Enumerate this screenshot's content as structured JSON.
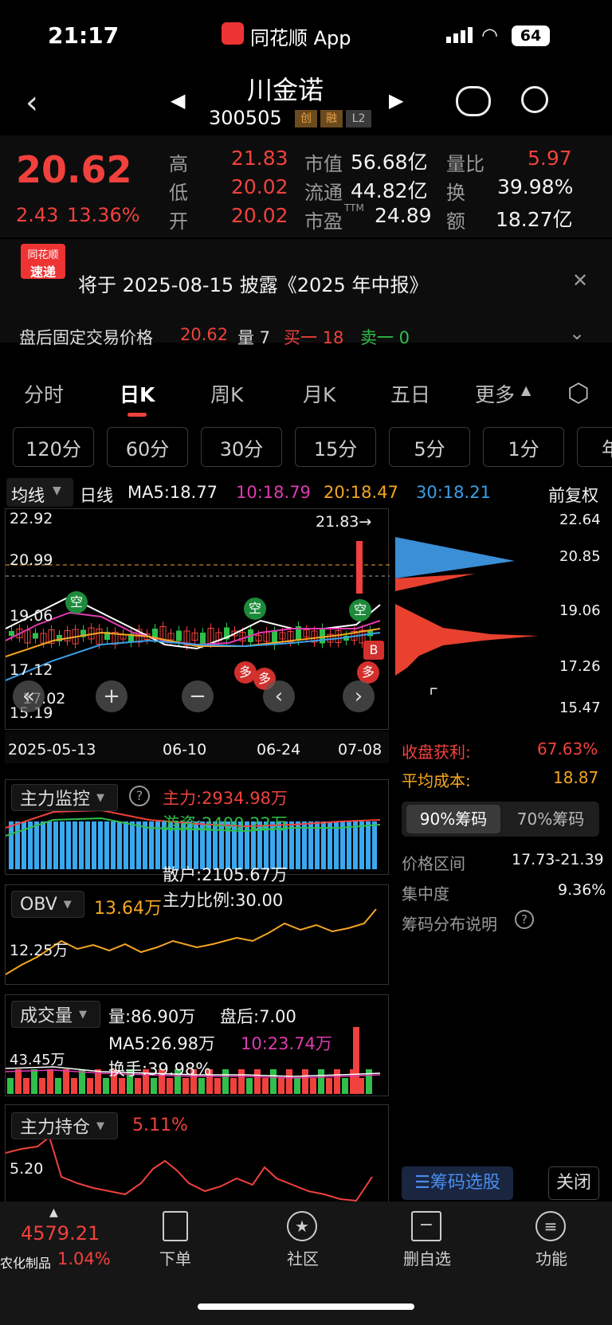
{
  "status": {
    "time": "21:17",
    "app": "同花顺 App",
    "battery": "64"
  },
  "header": {
    "name": "川金诺",
    "code": "300505",
    "tags": [
      "创",
      "融",
      "L2"
    ]
  },
  "quote": {
    "price": "20.62",
    "change": "2.43",
    "pct": "13.36%",
    "high_label": "高",
    "high": "21.83",
    "low_label": "低",
    "low": "20.02",
    "open_label": "开",
    "open": "20.02",
    "mcap_label": "市值",
    "mcap": "56.68亿",
    "float_label": "流通",
    "float": "44.82亿",
    "pe_label": "市盈",
    "pe_sup": "TTM",
    "pe": "24.89",
    "vr_label": "量比",
    "vr": "5.97",
    "turn_label": "换",
    "turn": "39.98%",
    "amt_label": "额",
    "amt": "18.27亿"
  },
  "news": {
    "logo1": "同花顺",
    "logo2": "速递",
    "text": "将于 2025-08-15 披露《2025 年中报》"
  },
  "after": {
    "label": "盘后固定交易价格",
    "price": "20.62",
    "vol": "量 7",
    "buy": "买一 18",
    "sell": "卖一 0"
  },
  "tabs": [
    "分时",
    "日K",
    "周K",
    "月K",
    "五日",
    "更多"
  ],
  "periods": [
    "120分",
    "60分",
    "30分",
    "15分",
    "5分",
    "1分",
    "年"
  ],
  "ma": {
    "sel": "均线",
    "type": "日线",
    "ma5": "MA5:18.77",
    "ma10": "10:18.79",
    "ma20": "20:18.47",
    "ma30": "30:18.21",
    "adj": "前复权"
  },
  "kline": {
    "y_top": "22.92",
    "y_2": "20.99",
    "y_3": "19.06",
    "y_4": "17.12",
    "y_5": "15.19",
    "hi": "21.83→",
    "lo": "17.02",
    "dates": [
      "2025-05-13",
      "06-10",
      "06-24",
      "07-08"
    ],
    "tags_k": [
      "空",
      "空",
      "空"
    ],
    "tags_d": [
      "多",
      "多",
      "多"
    ],
    "b": "B"
  },
  "chip": {
    "p1": "22.64",
    "p2": "20.85",
    "p3": "19.06",
    "p4": "17.26",
    "p5": "15.47",
    "profit_label": "收盘获利:",
    "profit": "67.63%",
    "cost_label": "平均成本:",
    "cost": "18.87",
    "tab1": "90%筹码",
    "tab2": "70%筹码",
    "range_label": "价格区间",
    "range": "17.73-21.39",
    "conc_label": "集中度",
    "conc": "9.36%",
    "explain": "筹码分布说明",
    "select": "筹码选股",
    "close": "关闭"
  },
  "ind1": {
    "name": "主力监控",
    "main": "主力:2934.98万",
    "hot": "游资:2400.22万",
    "retail": "散户:2105.67万",
    "ratio": "主力比例:30.00"
  },
  "obv": {
    "name": "OBV",
    "value": "13.64万",
    "axis": "12.25万"
  },
  "vol": {
    "name": "成交量",
    "v": "量:86.90万",
    "after": "盘后:7.00",
    "ma5": "MA5:26.98万",
    "ma10": "10:23.74万",
    "turn": "换手:39.98%",
    "axis": "43.45万"
  },
  "hold": {
    "name": "主力持仓",
    "value": "5.11%",
    "axis": "5.20"
  },
  "nav": {
    "index": "4579.21",
    "index_name": "农化制品",
    "index_pct": "1.04%",
    "order": "下单",
    "community": "社区",
    "remove": "删自选",
    "func": "功能"
  }
}
